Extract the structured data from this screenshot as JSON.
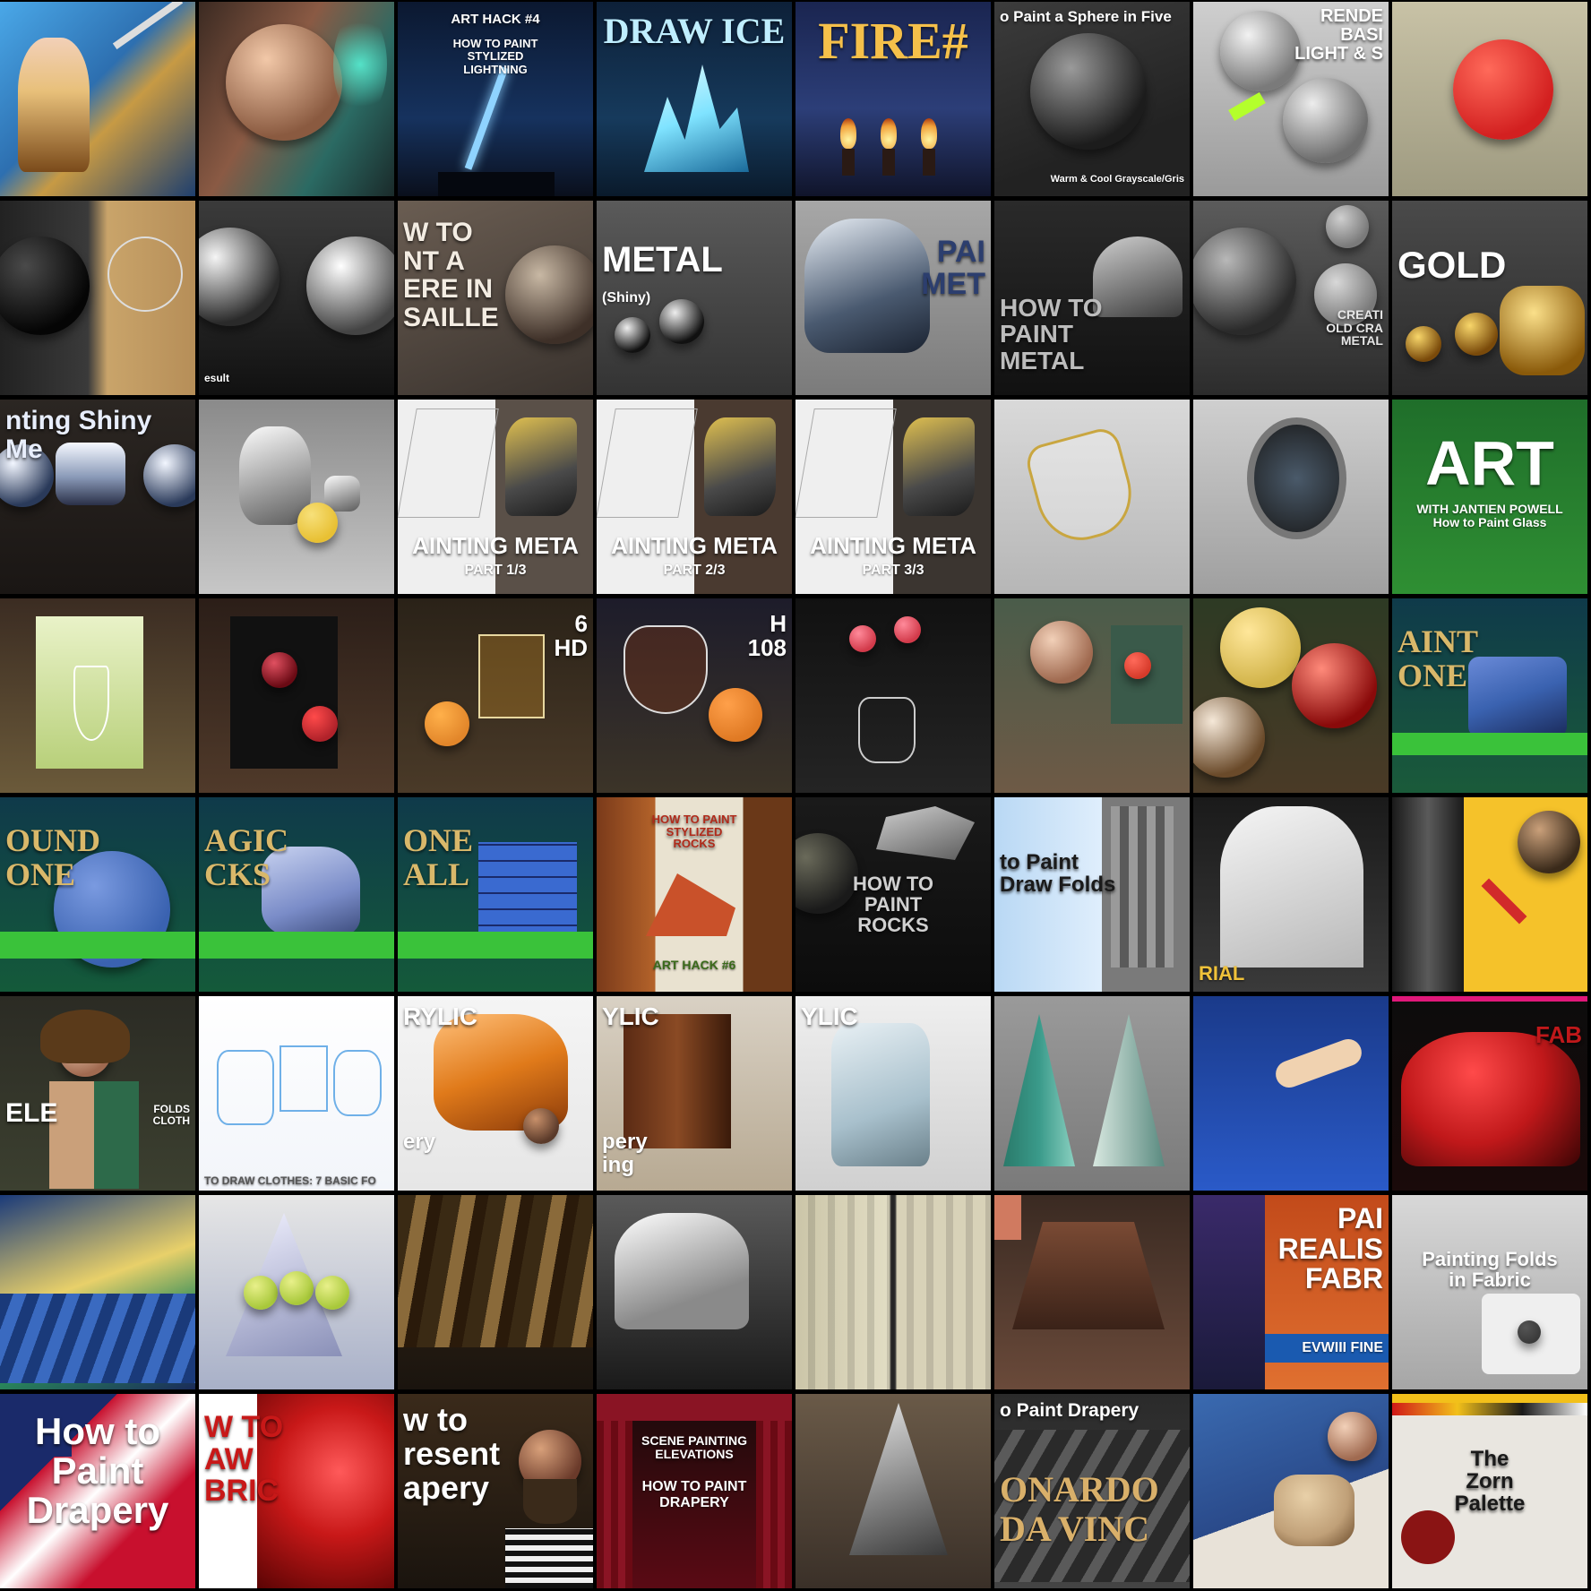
{
  "grid": {
    "rows": 8,
    "columns": 8,
    "thumbnails": [
      {
        "caption": "",
        "sub": "",
        "bg": "linear-gradient(135deg,#4aa8e8,#2d6fb0 45%,#c79a44 60%,#1e3f6e)",
        "motif": "figure",
        "accent": "#e8c07a"
      },
      {
        "caption": "",
        "sub": "",
        "bg": "linear-gradient(120deg,#3b2a22,#8a5a44 40%,#2b6a63 70%,#1a2a2a)",
        "motif": "face",
        "accent": "#54e2c8"
      },
      {
        "caption": "ART HACK #4",
        "sub": "HOW TO PAINT\nSTYLIZED\nLIGHTNING",
        "bg": "linear-gradient(180deg,#0b1830,#16325e 60%,#0a0f1c)",
        "motif": "bolt",
        "accent": "#8fd3ff"
      },
      {
        "caption": "DRAW ICE",
        "sub": "",
        "bg": "linear-gradient(180deg,#0d2038,#163a5c 60%,#0a1a2b)",
        "motif": "ice",
        "accent": "#7fe3ff"
      },
      {
        "caption": "FIRE#",
        "sub": "",
        "bg": "linear-gradient(180deg,#1a2550,#2c3e78 55%,#10142a)",
        "motif": "fire",
        "accent": "#f2a23a"
      },
      {
        "caption": "o Paint a Sphere in Five",
        "sub": "Warm & Cool Grayscale/Gris",
        "bg": "linear-gradient(160deg,#3c3c3c,#222 70%)",
        "motif": "sphere-gray",
        "accent": "#cfcfcf"
      },
      {
        "caption": "RENDE\nBASI\nLIGHT & S",
        "sub": "",
        "bg": "linear-gradient(180deg,#cfcfcf,#9a9a9a)",
        "motif": "sphere-light",
        "accent": "#b4ff2c"
      },
      {
        "caption": "",
        "sub": "",
        "bg": "linear-gradient(180deg,#c8c2a6,#9e9a80)",
        "motif": "sphere-red",
        "accent": "#d32020"
      },
      {
        "caption": "",
        "sub": "",
        "bg": "linear-gradient(90deg,#222,#3a3a3a 45%,#c9a46a 55%,#b68e58)",
        "motif": "sphere-dark",
        "accent": "#111"
      },
      {
        "caption": "",
        "sub": "esult",
        "bg": "linear-gradient(180deg,#3b3b3b,#111)",
        "motif": "chrome",
        "accent": "#e6e6e6"
      },
      {
        "caption": "W TO\nNT A\nERE IN\nSAILLE",
        "sub": "",
        "bg": "linear-gradient(160deg,#6a5d52,#3a332e)",
        "motif": "sphere-sepia",
        "accent": "#f3ece2"
      },
      {
        "caption": "METAL",
        "sub": "(Shiny)",
        "bg": "linear-gradient(180deg,#5a5a5a,#333)",
        "motif": "balls",
        "accent": "#ffffff"
      },
      {
        "caption": "PAI\nMET",
        "sub": "",
        "bg": "linear-gradient(180deg,#a7a7a7,#7b7b7b)",
        "motif": "armor",
        "accent": "#2c3e6e"
      },
      {
        "caption": "HOW TO\nPAINT\nMETAL",
        "sub": "",
        "bg": "linear-gradient(180deg,#2a2a2a,#111)",
        "motif": "helmet",
        "accent": "#a8a8a8"
      },
      {
        "caption": "CREATI\nOLD CRA\nMETAL",
        "sub": "",
        "bg": "linear-gradient(180deg,#5b5b5b,#2c2c2c)",
        "motif": "cracked",
        "accent": "#e7e7e7"
      },
      {
        "caption": "GOLD",
        "sub": "",
        "bg": "linear-gradient(180deg,#4a4a4a,#2a2a2a)",
        "motif": "gold",
        "accent": "#d9a62a"
      },
      {
        "caption": "nting Shiny Me",
        "sub": "",
        "bg": "linear-gradient(180deg,#2b2622,#1a1614)",
        "motif": "shiny",
        "accent": "#d8e8ff"
      },
      {
        "caption": "",
        "sub": "",
        "bg": "linear-gradient(180deg,#8a8a8a,#c7c7c7)",
        "motif": "teapot",
        "accent": "#e8c033"
      },
      {
        "caption": "AINTING META",
        "sub": "PART 1/3",
        "bg": "linear-gradient(90deg,#efefef 50%,#5a5048 50%)",
        "motif": "sketch",
        "accent": "#f2c13a"
      },
      {
        "caption": "AINTING META",
        "sub": "PART 2/3",
        "bg": "linear-gradient(90deg,#efefef 50%,#4a3a30 50%)",
        "motif": "sketch",
        "accent": "#f2c13a"
      },
      {
        "caption": "AINTING META",
        "sub": "PART 3/3",
        "bg": "linear-gradient(90deg,#efefef 50%,#3b3530 50%)",
        "motif": "sketch",
        "accent": "#f2c13a"
      },
      {
        "caption": "",
        "sub": "",
        "bg": "linear-gradient(180deg,#d9d9d9,#b6b6b6)",
        "motif": "glass",
        "accent": "#c9a640"
      },
      {
        "caption": "",
        "sub": "",
        "bg": "linear-gradient(180deg,#cfcfcf,#9f9f9f)",
        "motif": "mirror",
        "accent": "#666"
      },
      {
        "caption": "ART",
        "sub": "WITH JANTIEN POWELL\nHow to Paint Glass",
        "bg": "linear-gradient(180deg,#1f6e2a,#2f8f33)",
        "motif": "none",
        "accent": "#ffffff"
      },
      {
        "caption": "",
        "sub": "",
        "bg": "linear-gradient(180deg,#3b2c22,#6b5a3a)",
        "motif": "wine-white",
        "accent": "#c9e37a"
      },
      {
        "caption": "",
        "sub": "",
        "bg": "linear-gradient(180deg,#2b1e18,#503a2a)",
        "motif": "wine-red",
        "accent": "#b0222a"
      },
      {
        "caption": "6\nHD",
        "sub": "",
        "bg": "linear-gradient(180deg,#2a2218,#4a3a28)",
        "motif": "tumbler",
        "accent": "#e2862a"
      },
      {
        "caption": "H\n108",
        "sub": "",
        "bg": "linear-gradient(180deg,#1d1c2a,#3c3428)",
        "motif": "brandy",
        "accent": "#e07a24"
      },
      {
        "caption": "",
        "sub": "",
        "bg": "linear-gradient(180deg,#111,#242424)",
        "motif": "lilies",
        "accent": "#d23a4a"
      },
      {
        "caption": "",
        "sub": "",
        "bg": "linear-gradient(180deg,#4a5c4a,#6e5a46)",
        "motif": "painter",
        "accent": "#d63a2a"
      },
      {
        "caption": "",
        "sub": "",
        "bg": "linear-gradient(180deg,#2d3a24,#4a3a26)",
        "motif": "ornaments",
        "accent": "#d2b44a"
      },
      {
        "caption": "AINT\nONE",
        "sub": "",
        "bg": "linear-gradient(180deg,#0f3a4a,#1a5b3a)",
        "motif": "stone",
        "accent": "#3a62b0"
      },
      {
        "caption": "OUND\nONE",
        "sub": "",
        "bg": "linear-gradient(180deg,#0f3a4a,#145a3a)",
        "motif": "round-stone",
        "accent": "#3a62b0"
      },
      {
        "caption": "AGIC\nCKS",
        "sub": "",
        "bg": "linear-gradient(180deg,#0f3a4a,#145a3a)",
        "motif": "magic-rock",
        "accent": "#7a8cc8"
      },
      {
        "caption": "ONE\nALL",
        "sub": "",
        "bg": "linear-gradient(180deg,#0f3a4a,#145a3a)",
        "motif": "wall",
        "accent": "#3a6ad0"
      },
      {
        "caption": "HOW TO PAINT\nSTYLIZED\nROCKS",
        "sub": "ART HACK #6",
        "bg": "linear-gradient(90deg,#7a3a1a,#b4632a 30%,#e9e2d0 30%,#e9e2d0 75%,#6a3818 75%)",
        "motif": "rock-red",
        "accent": "#c9512a"
      },
      {
        "caption": "HOW TO\nPAINT\nROCKS",
        "sub": "",
        "bg": "linear-gradient(180deg,#1a1a1a,#0c0c0c)",
        "motif": "rocks",
        "accent": "#bcbcbc"
      },
      {
        "caption": "to Paint\nDraw Folds",
        "sub": "",
        "bg": "linear-gradient(90deg,#b9d8f4,#dfeefc 55%,#7a7a7a 55%)",
        "motif": "folds",
        "accent": "#222"
      },
      {
        "caption": "",
        "sub": "RIAL",
        "bg": "linear-gradient(180deg,#1a1a1a,#3a3a3a)",
        "motif": "shirt",
        "accent": "#f0c23a"
      },
      {
        "caption": "",
        "sub": "",
        "bg": "linear-gradient(90deg,#2a2a2a 35%,#f5c22a 35%)",
        "motif": "leather",
        "accent": "#d12a2a"
      },
      {
        "caption": "ELE",
        "sub": "FOLDS\nCLOTH",
        "bg": "linear-gradient(180deg,#2b2b24,#3c4030)",
        "motif": "woman",
        "accent": "#2d6a4a"
      },
      {
        "caption": "",
        "sub": "TO DRAW CLOTHES: 7 BASIC FO",
        "bg": "linear-gradient(180deg,#ffffff,#f2f5fa)",
        "motif": "sketch-blue",
        "accent": "#6fb0e8"
      },
      {
        "caption": "RYLIC",
        "sub": "ery",
        "bg": "linear-gradient(180deg,#f5f5f5,#e6e6e6)",
        "motif": "orange-cloth",
        "accent": "#e07a1a"
      },
      {
        "caption": "YLIC",
        "sub": "pery\ning",
        "bg": "linear-gradient(180deg,#d9d1c4,#b7a992)",
        "motif": "brown-cloth",
        "accent": "#8a4a24"
      },
      {
        "caption": "YLIC",
        "sub": "",
        "bg": "linear-gradient(180deg,#efefef,#d0d0d0)",
        "motif": "blue-cloth",
        "accent": "#a8c0cc"
      },
      {
        "caption": "",
        "sub": "",
        "bg": "linear-gradient(180deg,#9a9a9a,#7a7a7a)",
        "motif": "towels",
        "accent": "#3a9a8a"
      },
      {
        "caption": "",
        "sub": "",
        "bg": "linear-gradient(180deg,#1a3a8a,#2a5ac8)",
        "motif": "velvet",
        "accent": "#f0d2b0"
      },
      {
        "caption": "FAB",
        "sub": "",
        "bg": "linear-gradient(180deg,#0c0c0c,#1a0a0a)",
        "motif": "red-fabric",
        "accent": "#c0181a"
      },
      {
        "caption": "",
        "sub": "",
        "bg": "linear-gradient(160deg,#1a3a7a,#e8d06a 45%,#2a8a5a 70%,#1a2a5a)",
        "motif": "drape-flag",
        "accent": "#e0c050"
      },
      {
        "caption": "",
        "sub": "",
        "bg": "linear-gradient(180deg,#e6e6e6,#a8b0c8)",
        "motif": "apples",
        "accent": "#a8c83a"
      },
      {
        "caption": "",
        "sub": "",
        "bg": "linear-gradient(180deg,#3a2a1a,#1a140e)",
        "motif": "gold-drape",
        "accent": "#8a6a3a"
      },
      {
        "caption": "",
        "sub": "",
        "bg": "linear-gradient(180deg,#5a5a5a,#1a1a1a)",
        "motif": "white-drape",
        "accent": "#e6e6e6"
      },
      {
        "caption": "",
        "sub": "",
        "bg": "linear-gradient(90deg,#cbc5a8,#e2ddc4 48%,#2a2a2a 49%,#2a2a2a 51%,#d8d2b8 52%)",
        "motif": "curtain",
        "accent": "#bdb48e"
      },
      {
        "caption": "",
        "sub": "",
        "bg": "linear-gradient(180deg,#3a2a22,#6a4a3a)",
        "motif": "brown-drape",
        "accent": "#d07a60"
      },
      {
        "caption": "PAI\nREALIS\nFABR",
        "sub": "EVWIII FINE",
        "bg": "linear-gradient(180deg,#c24a1a,#e07030)",
        "motif": "realistic",
        "accent": "#1a5ab0"
      },
      {
        "caption": "Painting Folds\nin Fabric",
        "sub": "",
        "bg": "linear-gradient(180deg,#d8d8d8,#a6a6a6)",
        "motif": "palette",
        "accent": "#3a3a3a"
      },
      {
        "caption": "How to\nPaint\nDrapery",
        "sub": "",
        "bg": "linear-gradient(135deg,#1a2a6a 30%,#c8102e 30%,#ffffff 50%,#c8102e 70%)",
        "motif": "flag",
        "accent": "#ffffff"
      },
      {
        "caption": "W TO\nAW\nBRIC",
        "sub": "",
        "bg": "linear-gradient(90deg,#ffffff 30%,#c81818 30%)",
        "motif": "red-silk",
        "accent": "#c81818"
      },
      {
        "caption": "w to\nresent\napery",
        "sub": "",
        "bg": "linear-gradient(180deg,#3a2a1a,#1a140e)",
        "motif": "man",
        "accent": "#d81a1a"
      },
      {
        "caption": "SCENE PAINTING ELEVATIONS",
        "sub": "HOW TO PAINT\nDRAPERY",
        "bg": "linear-gradient(180deg,#1a0a0a,#5a0a14)",
        "motif": "stage",
        "accent": "#8a1424"
      },
      {
        "caption": "",
        "sub": "",
        "bg": "linear-gradient(180deg,#6a5a48,#3a3028)",
        "motif": "grey-drape",
        "accent": "#e6e6e6"
      },
      {
        "caption": "o Paint Drapery",
        "sub": "ONARDO\nDA VINC",
        "bg": "linear-gradient(180deg,#2a2a2a,#444)",
        "motif": "davinci",
        "accent": "#d9b06a"
      },
      {
        "caption": "",
        "sub": "",
        "bg": "linear-gradient(160deg,#3a6ab0,#2a4a8a 55%,#e8e2d8 55%)",
        "motif": "sculpt",
        "accent": "#c0a078"
      },
      {
        "caption": "The\nZorn\nPalette",
        "sub": "",
        "bg": "linear-gradient(180deg,#f2c01a 8%,#e9e6e0 8%)",
        "motif": "zorn",
        "accent": "#8a1414"
      }
    ]
  }
}
